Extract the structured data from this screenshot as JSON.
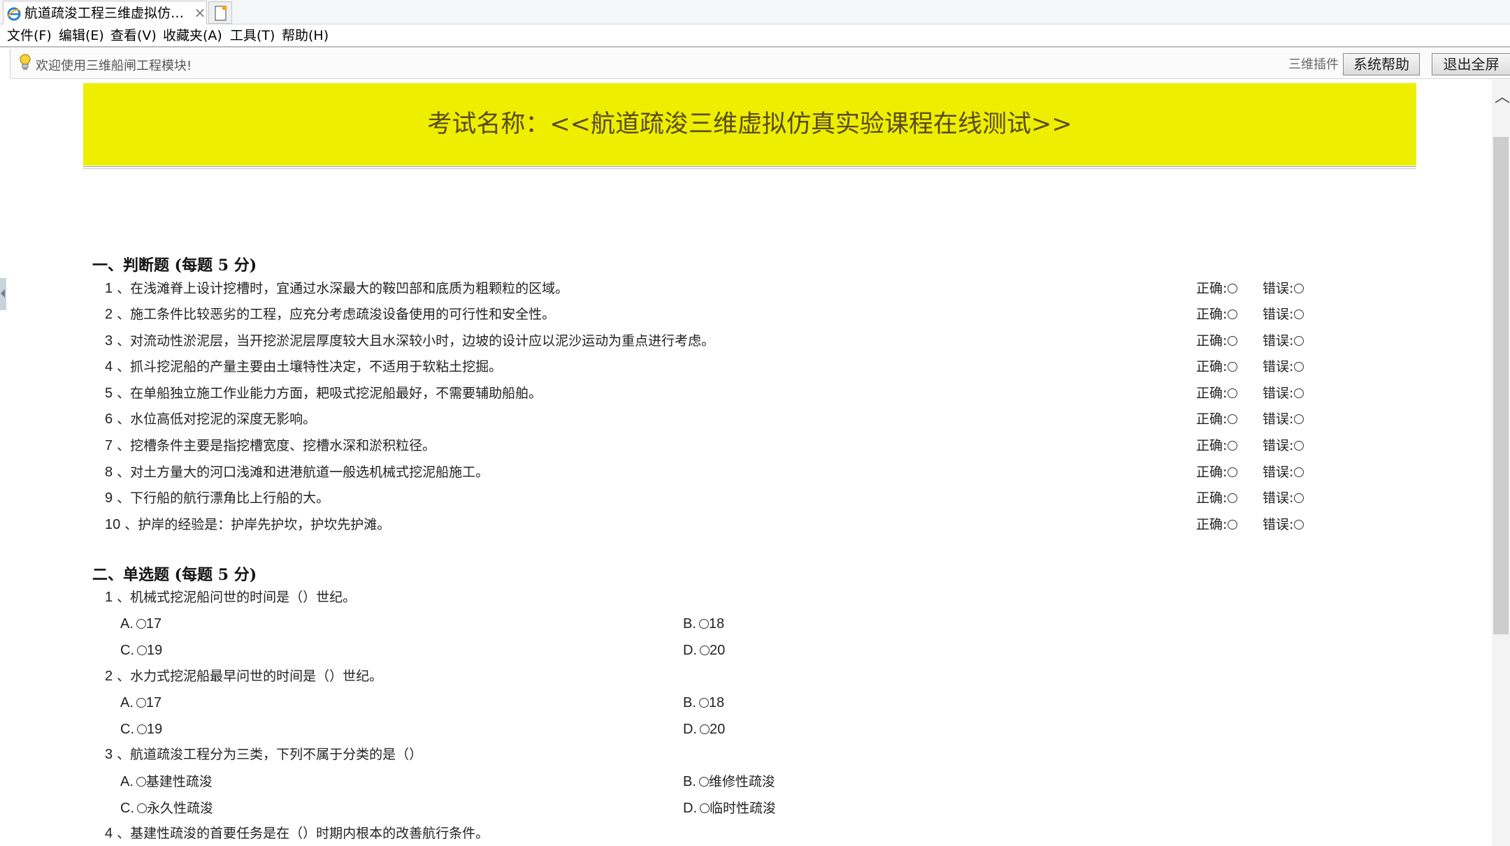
{
  "browser": {
    "tab_title": "航道疏浚工程三维虚拟仿真...",
    "tab_close": "×",
    "menu": [
      "文件(F)",
      "编辑(E)",
      "查看(V)",
      "收藏夹(A)",
      "工具(T)",
      "帮助(H)"
    ]
  },
  "infobar": {
    "welcome": "欢迎使用三维船闸工程模块!",
    "plugin_label": "三维插件",
    "help_button": "系统帮助",
    "exit_fullscreen_button": "退出全屏"
  },
  "exam": {
    "title": "考试名称：<<航道疏浚三维虚拟仿真实验课程在线测试>>"
  },
  "section1": {
    "title": "一、判断题 (每题 5 分)",
    "correct_label": "正确:",
    "wrong_label": "错误:",
    "questions": [
      {
        "num": "1",
        "text": "、在浅滩脊上设计挖槽时，宜通过水深最大的鞍凹部和底质为粗颗粒的区域。"
      },
      {
        "num": "2",
        "text": "、施工条件比较恶劣的工程，应充分考虑疏浚设备使用的可行性和安全性。"
      },
      {
        "num": "3",
        "text": "、对流动性淤泥层，当开挖淤泥层厚度较大且水深较小时，边坡的设计应以泥沙运动为重点进行考虑。"
      },
      {
        "num": "4",
        "text": "、抓斗挖泥船的产量主要由土壤特性决定，不适用于软粘土挖掘。"
      },
      {
        "num": "5",
        "text": "、在单船独立施工作业能力方面，耙吸式挖泥船最好，不需要辅助船舶。"
      },
      {
        "num": "6",
        "text": "、水位高低对挖泥的深度无影响。"
      },
      {
        "num": "7",
        "text": "、挖槽条件主要是指挖槽宽度、挖槽水深和淤积粒径。"
      },
      {
        "num": "8",
        "text": "、对土方量大的河口浅滩和进港航道一般选机械式挖泥船施工。"
      },
      {
        "num": "9",
        "text": "、下行船的航行漂角比上行船的大。"
      },
      {
        "num": "10",
        "text": "、护岸的经验是：护岸先护坎，护坎先护滩。"
      }
    ]
  },
  "section2": {
    "title": "二、单选题 (每题 5 分)",
    "questions": [
      {
        "num": "1",
        "text": "、机械式挖泥船问世的时间是（）世纪。",
        "options": [
          {
            "letter": "A.",
            "value": "17"
          },
          {
            "letter": "B.",
            "value": "18"
          },
          {
            "letter": "C.",
            "value": "19"
          },
          {
            "letter": "D.",
            "value": "20"
          }
        ]
      },
      {
        "num": "2",
        "text": "、水力式挖泥船最早问世的时间是（）世纪。",
        "options": [
          {
            "letter": "A.",
            "value": "17"
          },
          {
            "letter": "B.",
            "value": "18"
          },
          {
            "letter": "C.",
            "value": "19"
          },
          {
            "letter": "D.",
            "value": "20"
          }
        ]
      },
      {
        "num": "3",
        "text": "、航道疏浚工程分为三类，下列不属于分类的是（）",
        "options": [
          {
            "letter": "A.",
            "value": "基建性疏浚"
          },
          {
            "letter": "B.",
            "value": "维修性疏浚"
          },
          {
            "letter": "C.",
            "value": "永久性疏浚"
          },
          {
            "letter": "D.",
            "value": "临时性疏浚"
          }
        ]
      },
      {
        "num": "4",
        "text": "、基建性疏浚的首要任务是在（）时期内根本的改善航行条件。"
      }
    ]
  },
  "colors": {
    "banner": "#eeee00",
    "banner_text": "#5a4a1e"
  }
}
